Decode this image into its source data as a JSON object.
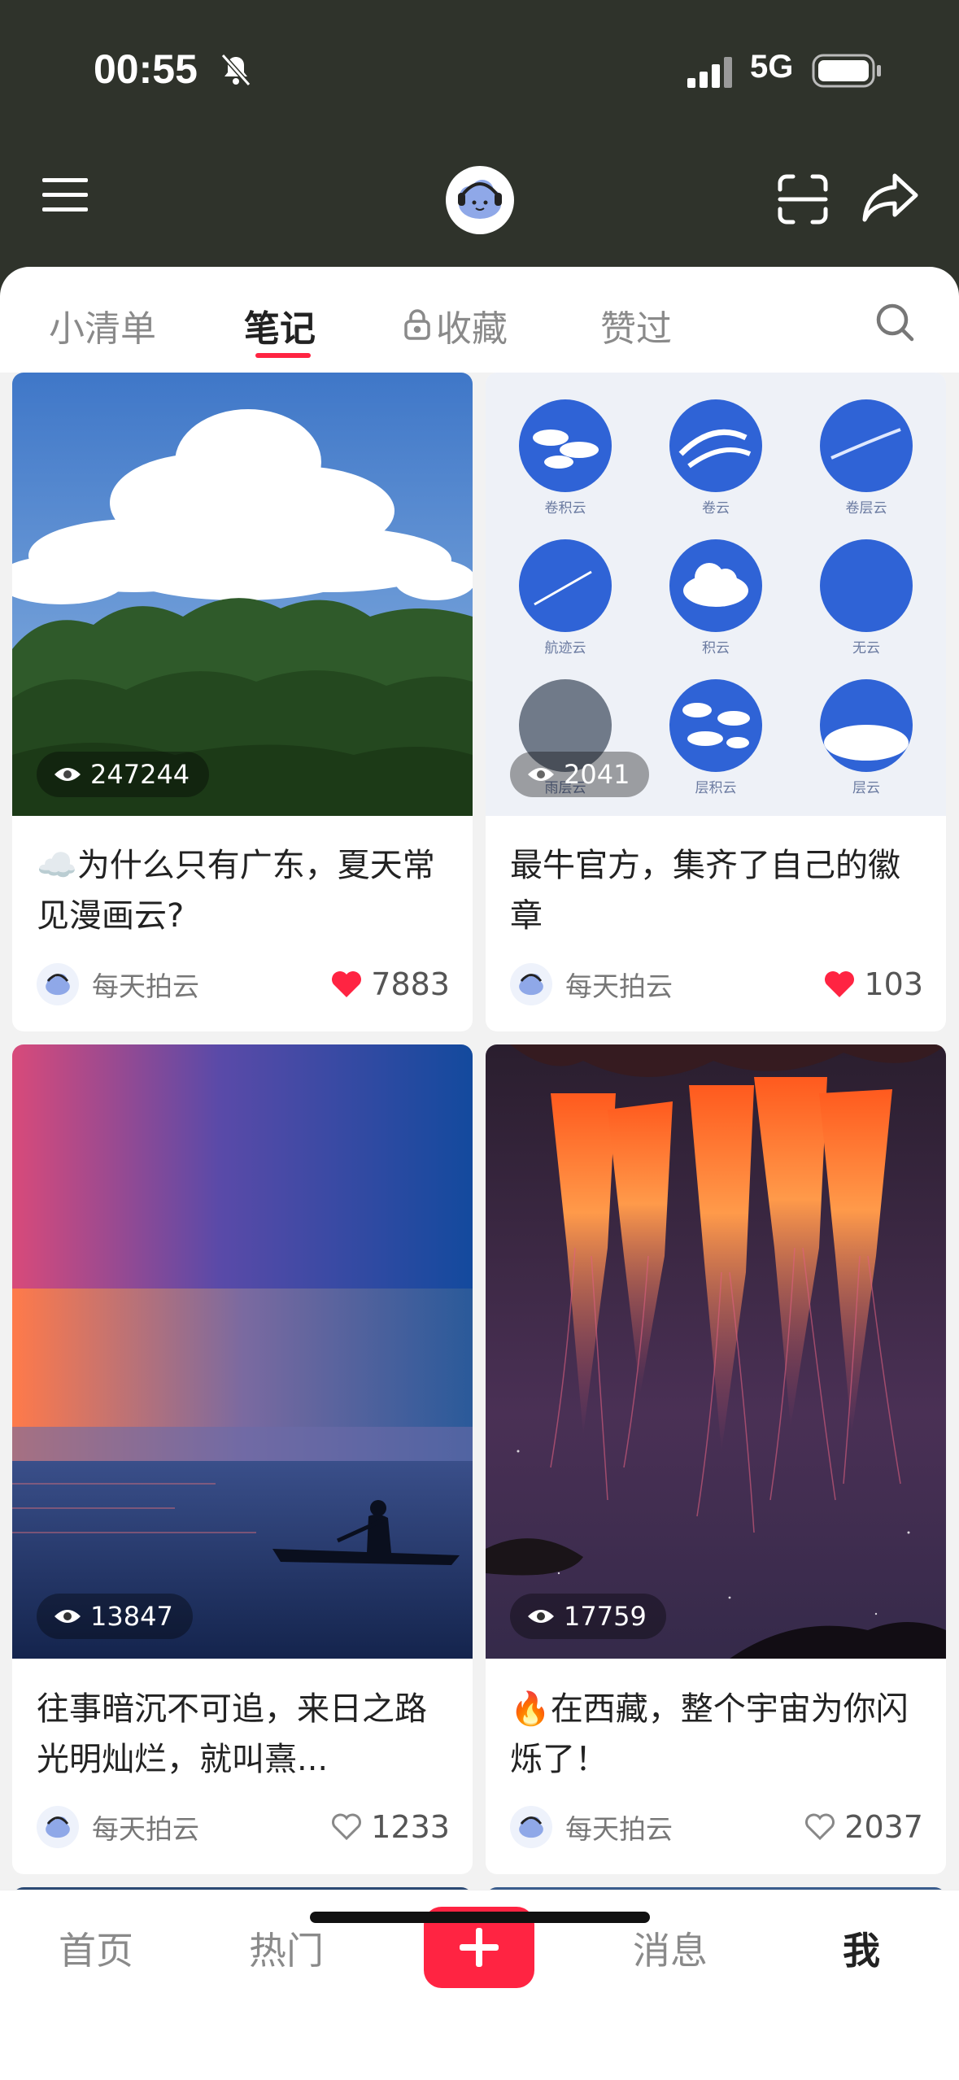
{
  "status": {
    "time": "00:55",
    "network": "5G"
  },
  "tabs": [
    {
      "label": "小清单"
    },
    {
      "label": "笔记"
    },
    {
      "label": "收藏"
    },
    {
      "label": "赞过"
    }
  ],
  "cloud_chart_labels": [
    "卷积云",
    "卷云",
    "卷层云",
    "航迹云",
    "积云",
    "无云",
    "雨层云",
    "层积云",
    "层云"
  ],
  "cards": [
    {
      "views": "247244",
      "title": "为什么只有广东，夏天常见漫画云?",
      "author": "每天拍云",
      "likes": "7883",
      "liked": true,
      "emoji": "☁️"
    },
    {
      "views": "2041",
      "title": "最牛官方，集齐了自己的徽章",
      "author": "每天拍云",
      "likes": "103",
      "liked": true
    },
    {
      "views": "13847",
      "title": "往事暗沉不可追，来日之路光明灿烂，就叫熹...",
      "author": "每天拍云",
      "likes": "1233",
      "liked": false
    },
    {
      "views": "17759",
      "title": "在西藏，整个宇宙为你闪烁了！",
      "author": "每天拍云",
      "likes": "2037",
      "liked": false,
      "emoji": "🔥"
    }
  ],
  "bottom_nav": [
    {
      "label": "首页"
    },
    {
      "label": "热门"
    },
    {
      "label": "消息"
    },
    {
      "label": "我"
    }
  ],
  "colors": {
    "accent": "#ff2442",
    "header_bg": "#2f332b"
  }
}
